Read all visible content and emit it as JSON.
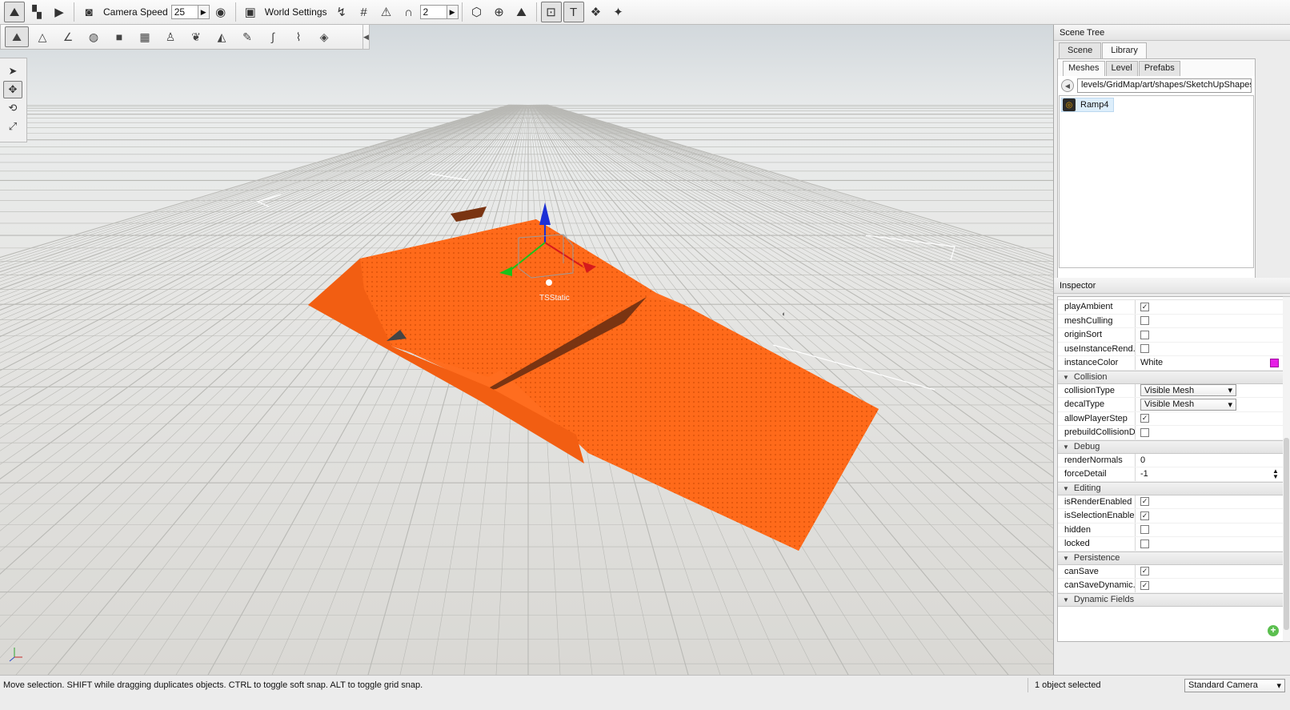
{
  "toolbar": {
    "camera_speed_label": "Camera Speed",
    "camera_speed_value": "25",
    "world_settings_label": "World Settings",
    "snap_value": "2"
  },
  "viewport": {
    "object_label": "TSStatic",
    "object_color": "#ff6a1a"
  },
  "scene_tree": {
    "title": "Scene Tree",
    "tabs": [
      "Scene",
      "Library"
    ],
    "active_tab": "Library",
    "sub_tabs": [
      "Meshes",
      "Level",
      "Prefabs"
    ],
    "active_sub_tab": "Meshes",
    "path": "levels/GridMap/art/shapes/SketchUpShapes",
    "items": [
      {
        "label": "Ramp4"
      }
    ]
  },
  "inspector": {
    "title": "Inspector",
    "rows_top": [
      {
        "name": "playAmbient",
        "checked": true
      },
      {
        "name": "meshCulling",
        "checked": false
      },
      {
        "name": "originSort",
        "checked": false
      },
      {
        "name": "useInstanceRend...",
        "checked": false
      }
    ],
    "instance_color": {
      "name": "instanceColor",
      "value": "White",
      "swatch": "#e61ee6"
    },
    "groups": {
      "collision": "Collision",
      "debug": "Debug",
      "editing": "Editing",
      "persistence": "Persistence",
      "dynamic_fields": "Dynamic Fields"
    },
    "collision": {
      "collision_type": {
        "name": "collisionType",
        "value": "Visible Mesh"
      },
      "decal_type": {
        "name": "decalType",
        "value": "Visible Mesh"
      },
      "allow_player_step": {
        "name": "allowPlayerStep",
        "checked": true
      },
      "prebuild": {
        "name": "prebuildCollisionD...",
        "checked": false
      }
    },
    "debug": {
      "render_normals": {
        "name": "renderNormals",
        "value": "0"
      },
      "force_detail": {
        "name": "forceDetail",
        "value": "-1"
      }
    },
    "editing": [
      {
        "name": "isRenderEnabled",
        "checked": true
      },
      {
        "name": "isSelectionEnabled",
        "checked": true
      },
      {
        "name": "hidden",
        "checked": false
      },
      {
        "name": "locked",
        "checked": false
      }
    ],
    "persistence": [
      {
        "name": "canSave",
        "checked": true
      },
      {
        "name": "canSaveDynamic...",
        "checked": true
      }
    ]
  },
  "status": {
    "message": "Move selection.  SHIFT while dragging duplicates objects.  CTRL to toggle soft snap.  ALT to toggle grid snap.",
    "selection_count": "1 object selected",
    "camera_mode": "Standard Camera"
  }
}
